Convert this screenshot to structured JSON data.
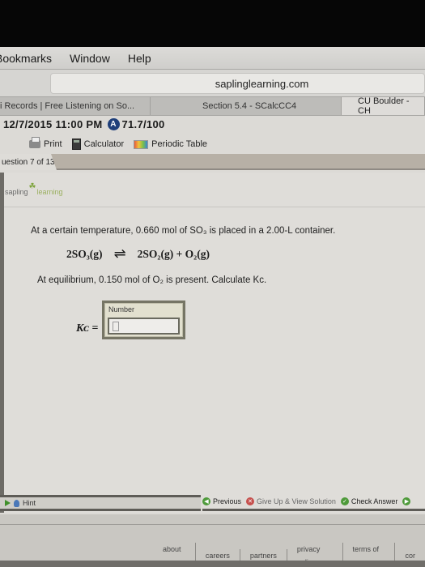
{
  "menubar": {
    "items": [
      "Bookmarks",
      "Window",
      "Help"
    ]
  },
  "browser": {
    "url": "saplinglearning.com",
    "tabs": [
      "i Records | Free Listening on So...",
      "Section 5.4 - SCalcCC4",
      "CU Boulder - CH"
    ]
  },
  "assignment": {
    "due": "12/7/2015 11:00 PM",
    "badge": "A",
    "score": "71.7/100"
  },
  "tools": {
    "print": "Print",
    "calculator": "Calculator",
    "periodic_table": "Periodic Table"
  },
  "question_tab": "uestion 7 of 13",
  "logo": {
    "part1": "sapling",
    "part2": "learning"
  },
  "question": {
    "intro": "At a certain temperature, 0.660 mol of SO₃ is placed in a 2.00-L container.",
    "equation_left": "2SO₃(g)",
    "equation_arrow": "⇌",
    "equation_right": "2SO₂(g) + O₂(g)",
    "prompt": "At equilibrium, 0.150 mol of O₂ is present. Calculate Kᴄ.",
    "answer_label": "Kᴄ =",
    "answer_box_label": "Number",
    "answer_value": ""
  },
  "actions": {
    "hint": "Hint",
    "previous": "Previous",
    "give_up": "Give Up & View Solution",
    "check": "Check Answer"
  },
  "footer": {
    "links": [
      "about us",
      "careers",
      "partners",
      "privacy policy",
      "terms of use",
      "cor"
    ]
  },
  "colors": {
    "accent_green": "#4e9a3a",
    "give_up_red": "#c6504d",
    "badge_blue": "#1f3f7a"
  }
}
